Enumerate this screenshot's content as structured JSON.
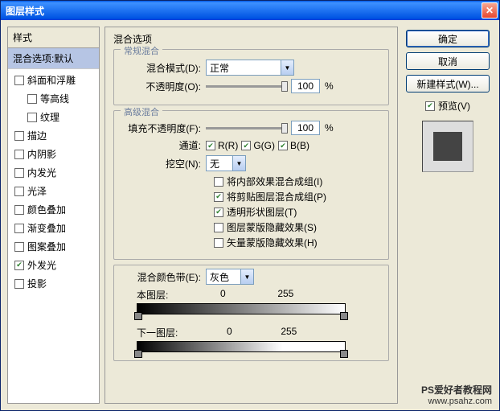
{
  "titlebar": {
    "title": "图层样式"
  },
  "left": {
    "header": "样式",
    "selected": "混合选项:默认",
    "items": [
      {
        "label": "斜面和浮雕",
        "checked": false,
        "indent": false
      },
      {
        "label": "等高线",
        "checked": false,
        "indent": true
      },
      {
        "label": "纹理",
        "checked": false,
        "indent": true
      },
      {
        "label": "描边",
        "checked": false,
        "indent": false
      },
      {
        "label": "内阴影",
        "checked": false,
        "indent": false
      },
      {
        "label": "内发光",
        "checked": false,
        "indent": false
      },
      {
        "label": "光泽",
        "checked": false,
        "indent": false
      },
      {
        "label": "颜色叠加",
        "checked": false,
        "indent": false
      },
      {
        "label": "渐变叠加",
        "checked": false,
        "indent": false
      },
      {
        "label": "图案叠加",
        "checked": false,
        "indent": false
      },
      {
        "label": "外发光",
        "checked": true,
        "indent": false
      },
      {
        "label": "投影",
        "checked": false,
        "indent": false
      }
    ]
  },
  "middle": {
    "title": "混合选项",
    "general": {
      "label": "常规混合",
      "blend_mode_label": "混合模式(D):",
      "blend_mode_value": "正常",
      "opacity_label": "不透明度(O):",
      "opacity_value": "100",
      "opacity_unit": "%"
    },
    "advanced": {
      "label": "高级混合",
      "fill_label": "填充不透明度(F):",
      "fill_value": "100",
      "fill_unit": "%",
      "channel_label": "通道:",
      "channels": [
        {
          "label": "R(R)",
          "checked": true
        },
        {
          "label": "G(G)",
          "checked": true
        },
        {
          "label": "B(B)",
          "checked": true
        }
      ],
      "knockout_label": "挖空(N):",
      "knockout_value": "无",
      "options": [
        {
          "label": "将内部效果混合成组(I)",
          "checked": false
        },
        {
          "label": "将剪贴图层混合成组(P)",
          "checked": true
        },
        {
          "label": "透明形状图层(T)",
          "checked": true
        },
        {
          "label": "图层蒙版隐藏效果(S)",
          "checked": false
        },
        {
          "label": "矢量蒙版隐藏效果(H)",
          "checked": false
        }
      ]
    },
    "blendif": {
      "label_row": "混合颜色带(E):",
      "value": "灰色",
      "this_layer": "本图层:",
      "under_layer": "下一图层:",
      "min": "0",
      "max": "255"
    }
  },
  "right": {
    "ok": "确定",
    "cancel": "取消",
    "newstyle": "新建样式(W)...",
    "preview": "预览(V)"
  },
  "watermark": {
    "line1": "PS爱好者教程网",
    "line2": "www.psahz.com"
  }
}
